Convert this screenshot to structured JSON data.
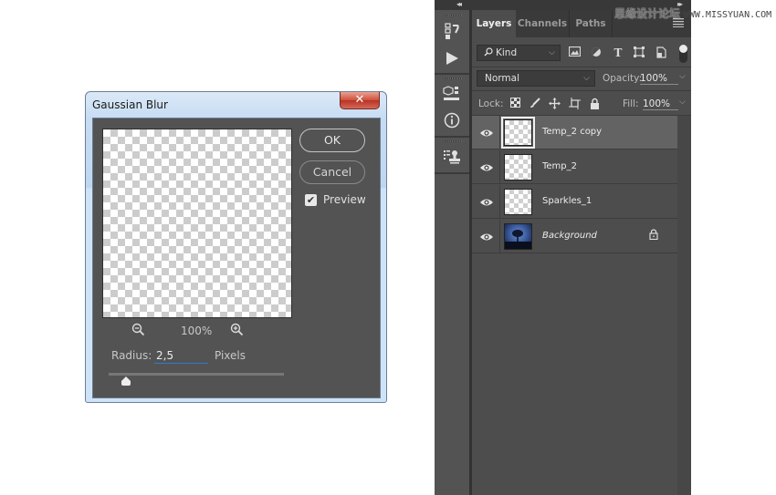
{
  "dialog": {
    "title": "Gaussian Blur",
    "close_label": "✕",
    "ok_label": "OK",
    "cancel_label": "Cancel",
    "preview_label": "Preview",
    "preview_checked": true,
    "zoom_level": "100%",
    "radius_label": "Radius:",
    "radius_value": "2,5",
    "units_label": "Pixels",
    "zoom_out_icon": "zoom-out-icon",
    "zoom_in_icon": "zoom-in-icon"
  },
  "panel": {
    "collapse_left": "◂◂",
    "collapse_right": "▸▸",
    "tabs": [
      {
        "label": "Layers",
        "active": true
      },
      {
        "label": "Channels",
        "active": false
      },
      {
        "label": "Paths",
        "active": false
      }
    ],
    "filter": {
      "label": "Kind",
      "icon": "search-icon"
    },
    "blend_mode": "Normal",
    "opacity_label": "Opacity:",
    "opacity_value": "100%",
    "lock_label": "Lock:",
    "fill_label": "Fill:",
    "fill_value": "100%",
    "layers": [
      {
        "name": "Temp_2 copy",
        "selected": true,
        "visible": true,
        "locked": false,
        "italic": false
      },
      {
        "name": "Temp_2",
        "selected": false,
        "visible": true,
        "locked": false,
        "italic": false
      },
      {
        "name": "Sparkles_1",
        "selected": false,
        "visible": true,
        "locked": false,
        "italic": false
      },
      {
        "name": "Background",
        "selected": false,
        "visible": true,
        "locked": true,
        "italic": true
      }
    ]
  },
  "iconbar": {
    "items": [
      "history-icon",
      "actions-play-icon",
      "3d-icon",
      "info-icon",
      "clone-source-icon"
    ]
  },
  "watermark": {
    "chinese": "思缘设计论坛",
    "url": "WWW.MISSYUAN.COM"
  }
}
